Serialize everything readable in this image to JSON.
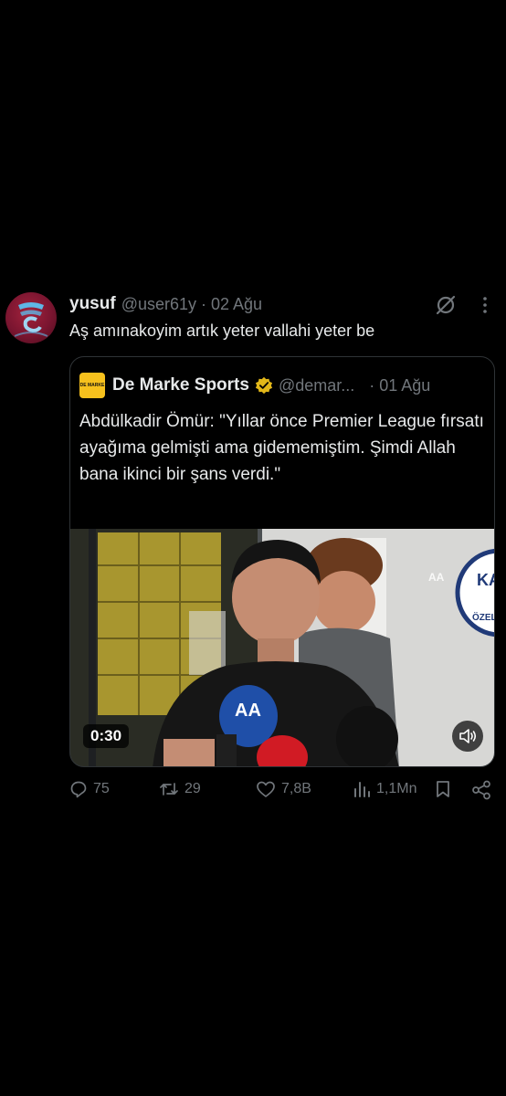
{
  "tweet": {
    "display_name": "yusuf",
    "handle_date": "@user61y · 02 Ağu",
    "text": "Aş amınakoyim artık yeter vallahi yeter be"
  },
  "quote": {
    "logo_text": "DE MARKE",
    "display_name": "De Marke Sports",
    "handle": "@demar...",
    "date": "· 01 Ağu",
    "text": "Abdülkadir Ömür: \"Yıllar önce Premier League fırsatı ayağıma gelmişti ama gidememiştim. Şimdi Allah bana ikinci bir şans verdi.\"",
    "video": {
      "duration": "0:30",
      "watermark": "AA",
      "mic_label": "AA",
      "wall_sign": "KAS ÖZEL"
    }
  },
  "actions": {
    "replies": "75",
    "reposts": "29",
    "likes": "7,8B",
    "views": "1,1Mn"
  },
  "colors": {
    "background": "#000000",
    "primary_text": "#e7e9ea",
    "secondary_text": "#71767b",
    "verified_gold": "#e2b719",
    "border": "#2f3336"
  },
  "icons": [
    "grok-icon",
    "more-icon",
    "verified-badge-icon",
    "volume-icon",
    "reply-icon",
    "repost-icon",
    "like-icon",
    "views-icon",
    "bookmark-icon",
    "share-icon"
  ]
}
